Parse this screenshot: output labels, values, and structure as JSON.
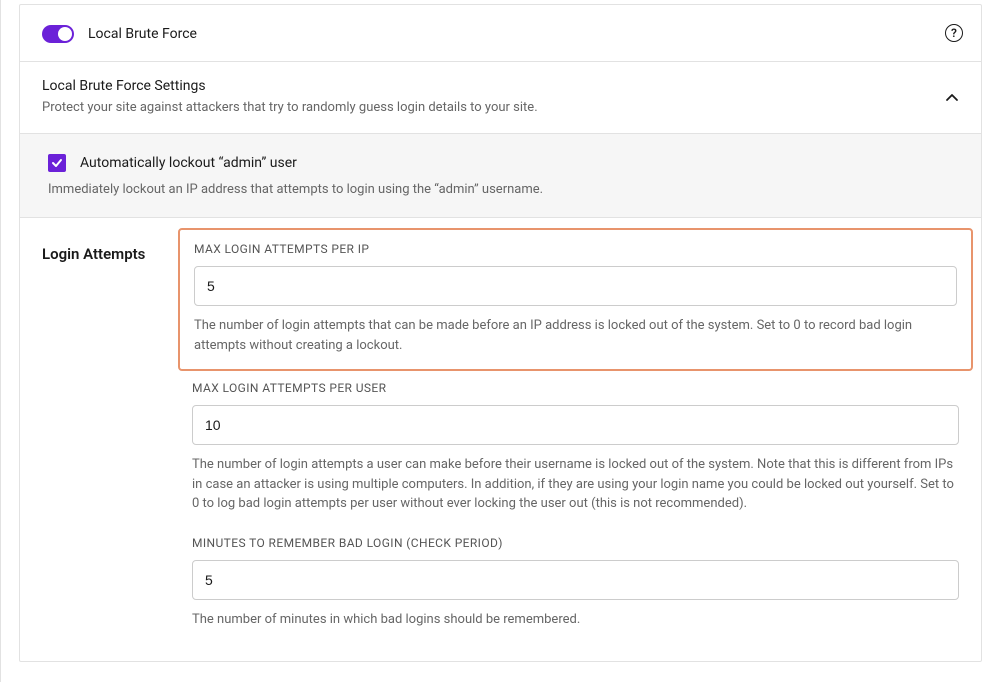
{
  "header": {
    "toggle_label": "Local Brute Force",
    "help_glyph": "?"
  },
  "settings_title": {
    "title": "Local Brute Force Settings",
    "subtitle": "Protect your site against attackers that try to randomly guess login details to your site."
  },
  "admin_lockout": {
    "label": "Automatically lockout “admin” user",
    "desc": "Immediately lockout an IP address that attempts to login using the “admin” username."
  },
  "login_attempts": {
    "section_label": "Login Attempts",
    "fields": [
      {
        "label": "MAX LOGIN ATTEMPTS PER IP",
        "value": "5",
        "desc": "The number of login attempts that can be made before an IP address is locked out of the system. Set to 0 to record bad login attempts without creating a lockout."
      },
      {
        "label": "MAX LOGIN ATTEMPTS PER USER",
        "value": "10",
        "desc": "The number of login attempts a user can make before their username is locked out of the system. Note that this is different from IPs in case an attacker is using multiple computers. In addition, if they are using your login name you could be locked out yourself. Set to 0 to log bad login attempts per user without ever locking the user out (this is not recommended)."
      },
      {
        "label": "MINUTES TO REMEMBER BAD LOGIN (CHECK PERIOD)",
        "value": "5",
        "desc": "The number of minutes in which bad logins should be remembered."
      }
    ]
  }
}
